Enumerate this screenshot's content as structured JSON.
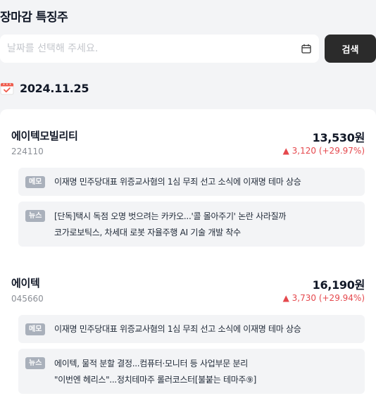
{
  "header": {
    "title": "장마감 특징주"
  },
  "search": {
    "placeholder": "날짜를 선택해 주세요.",
    "value": "",
    "button_label": "검색"
  },
  "date_heading": {
    "date": "2024.11.25",
    "icon": "calendar-check-icon"
  },
  "stocks": [
    {
      "name": "에이텍모빌리티",
      "code": "224110",
      "price": "13,530원",
      "change": "▲ 3,120 (+29.97%)",
      "memo": {
        "badge": "메모",
        "lines": [
          "이재명 민주당대표 위증교사혐의 1심 무죄 선고 소식에 이재명 테마 상승"
        ]
      },
      "news": {
        "badge": "뉴스",
        "lines": [
          "[단독]택시 독점 오명 벗으려는 카카오...'콜 몰아주기' 논란 사라질까",
          "코가로보틱스, 차세대 로봇 자율주행 AI 기술 개발 착수"
        ]
      }
    },
    {
      "name": "에이텍",
      "code": "045660",
      "price": "16,190원",
      "change": "▲ 3,730 (+29.94%)",
      "memo": {
        "badge": "메모",
        "lines": [
          "이재명 민주당대표 위증교사혐의 1심 무죄 선고 소식에 이재명 테마 상승"
        ]
      },
      "news": {
        "badge": "뉴스",
        "lines": [
          "에이텍, 물적 분할 결정...컴퓨터·모니터 등 사업부문 분리",
          "\"이번엔 헤리스\"...정치테마주 롤러코스터[불붙는 테마주⑨]"
        ]
      }
    }
  ],
  "colors": {
    "accent_up": "#e5484d",
    "button_bg": "#2b2b2b",
    "badge_bg": "#a9b0bb",
    "page_bg": "#f3f4f6"
  }
}
